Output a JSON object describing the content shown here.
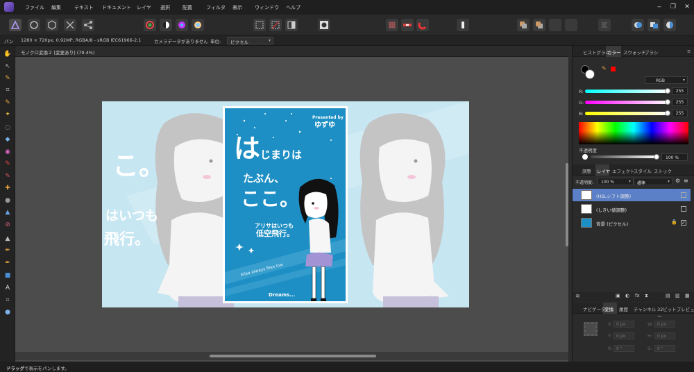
{
  "menubar": {
    "items": [
      "ファイル",
      "編集",
      "テキスト",
      "ドキュメント",
      "レイヤ",
      "選択",
      "配置",
      "フィルタ",
      "表示",
      "ウィンドウ",
      "ヘルプ"
    ]
  },
  "context": {
    "hint": "パン",
    "doc_info": "1280 × 720px, 0.92MP, RGBA/8 - sRGB IEC61966-2.1",
    "camera": "カメラデータがありません",
    "unit_label": "単位:",
    "unit_value": "ピクセル"
  },
  "document": {
    "tab_title": "モノクロ変換２ [変更あり] (79.4%)"
  },
  "artwork": {
    "presented_by": "Presented by",
    "author": "ゆずゆ",
    "title_big": "は",
    "title_1": "じまりは",
    "title_2": "たぶん、",
    "title_3": "ここ。",
    "subtitle_1": "アリサはいつも",
    "subtitle_2": "低空飛行。",
    "english": "Alisa always flies low",
    "dreams": "Dreams...",
    "bg_text_1": "はいつも",
    "bg_text_2": "飛行。",
    "bg_text_3": "こ。"
  },
  "color_panel": {
    "tabs": [
      "ヒストグラム",
      "カラー",
      "スウォッチ",
      "ブラシ"
    ],
    "active_tab": "カラー",
    "mode": "RGB",
    "r_label": "R:",
    "g_label": "G:",
    "b_label": "B:",
    "r": "255",
    "g": "255",
    "b": "255",
    "opacity_label": "不透明度",
    "opacity": "100 %",
    "colors": {
      "fill": "#ffffff",
      "stroke": "#000000",
      "swatch": "#ff0000"
    }
  },
  "layers_panel": {
    "tabs": [
      "調整",
      "レイヤ",
      "エフェクト",
      "スタイル",
      "ストック"
    ],
    "active_tab": "レイヤ",
    "opacity_label": "不透明度:",
    "opacity": "100 %",
    "blend": "標準",
    "layers": [
      {
        "name": "(HSLシフト調整)",
        "selected": true
      },
      {
        "name": "(しきい値調整)",
        "selected": false
      },
      {
        "name": "背景 (ピクセル)",
        "selected": false
      }
    ]
  },
  "transform_panel": {
    "tabs": [
      "ナビゲータ",
      "変換",
      "履歴",
      "チャンネル",
      "32ビットプレビュー"
    ],
    "active_tab": "変換",
    "x_label": "X:",
    "x": "0 px",
    "y_label": "Y:",
    "y": "0 px",
    "w_label": "W:",
    "w": "0 px",
    "h_label": "H:",
    "h": "0 px",
    "r_label": "R:",
    "r": "0 °",
    "s_label": "S:",
    "s": "0 °"
  },
  "status": {
    "text_bold": "ドラッグ",
    "text": "で表示をパンします。"
  },
  "theme": {
    "accent": "#5b80c7",
    "canvas_bg": "#4c4c4c",
    "poster_blue": "#1e8fc4",
    "poster_light": "#c6e6f2"
  }
}
